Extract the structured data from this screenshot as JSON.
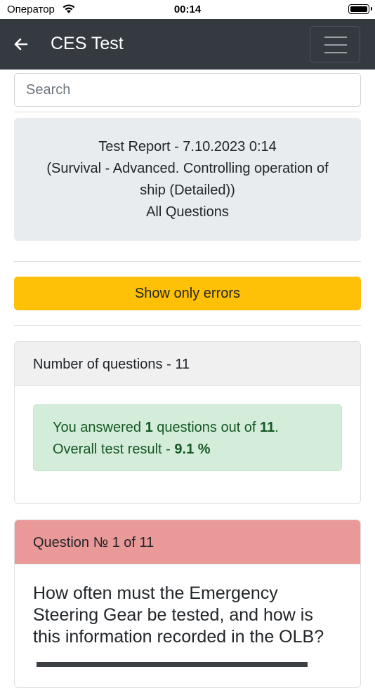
{
  "status_bar": {
    "carrier": "Оператор",
    "time": "00:14"
  },
  "navbar": {
    "title": "CES Test"
  },
  "search": {
    "placeholder": "Search"
  },
  "report": {
    "line1": "Test Report - 7.10.2023 0:14",
    "line2": "(Survival - Advanced. Controlling operation of ship (Detailed))",
    "line3": "All Questions"
  },
  "filter_button": {
    "label": "Show only errors"
  },
  "summary": {
    "header": "Number of questions - 11",
    "answered_prefix": "You answered ",
    "answered_count": "1",
    "answered_middle": " questions out of ",
    "total": "11",
    "answered_suffix": ".",
    "result_prefix": "Overall test result - ",
    "result_value": "9.1 %"
  },
  "question": {
    "header": "Question № 1 of 11",
    "text": "How often must the Emergency Steering Gear be tested, and how is this information recorded in the OLB?"
  },
  "colors": {
    "navbar_bg": "#343a40",
    "warning_button": "#ffc107",
    "success_alert_bg": "#d4edda",
    "success_text": "#155724",
    "question_error_header": "#ea9999"
  }
}
